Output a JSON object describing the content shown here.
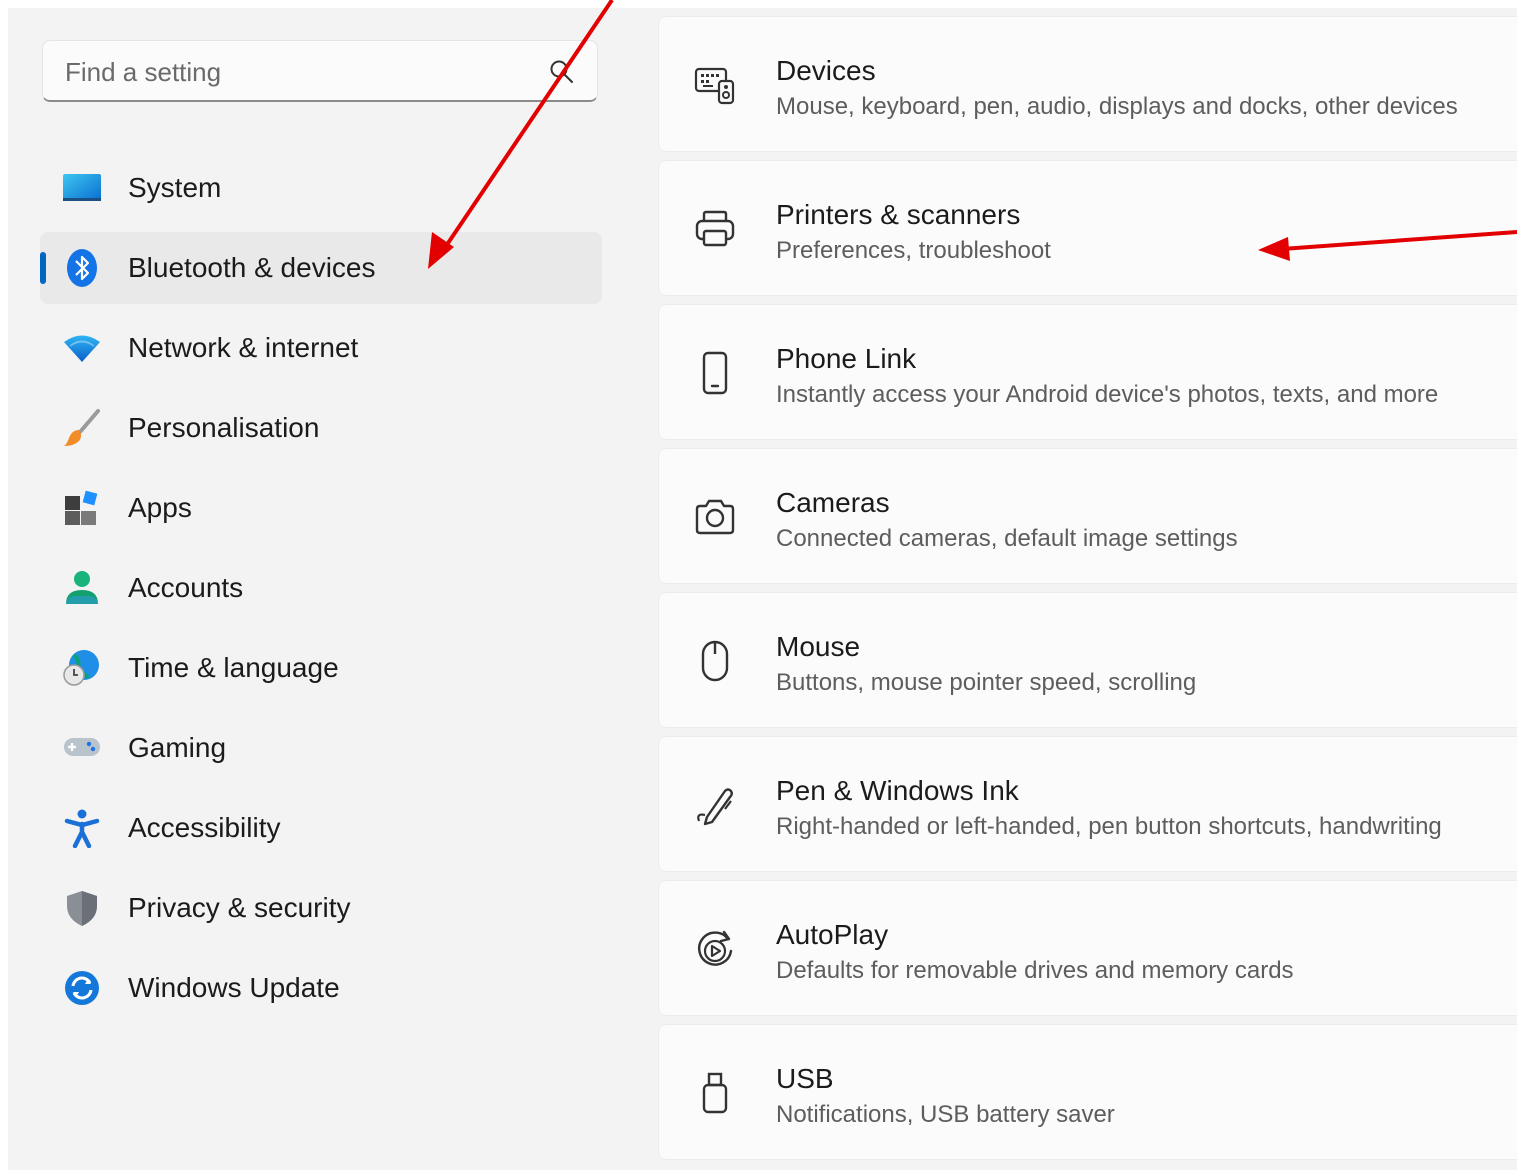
{
  "search": {
    "placeholder": "Find a setting"
  },
  "nav": {
    "items": [
      {
        "label": "System",
        "icon": "monitor-icon"
      },
      {
        "label": "Bluetooth & devices",
        "icon": "bluetooth-icon",
        "selected": true
      },
      {
        "label": "Network & internet",
        "icon": "wifi-icon"
      },
      {
        "label": "Personalisation",
        "icon": "paintbrush-icon"
      },
      {
        "label": "Apps",
        "icon": "apps-icon"
      },
      {
        "label": "Accounts",
        "icon": "person-icon"
      },
      {
        "label": "Time & language",
        "icon": "globe-clock-icon"
      },
      {
        "label": "Gaming",
        "icon": "gamepad-icon"
      },
      {
        "label": "Accessibility",
        "icon": "accessibility-icon"
      },
      {
        "label": "Privacy & security",
        "icon": "shield-icon"
      },
      {
        "label": "Windows Update",
        "icon": "update-icon"
      }
    ]
  },
  "cards": [
    {
      "title": "Devices",
      "subtitle": "Mouse, keyboard, pen, audio, displays and docks, other devices",
      "icon": "devices-icon"
    },
    {
      "title": "Printers & scanners",
      "subtitle": "Preferences, troubleshoot",
      "icon": "printer-icon"
    },
    {
      "title": "Phone Link",
      "subtitle": "Instantly access your Android device's photos, texts, and more",
      "icon": "phone-icon"
    },
    {
      "title": "Cameras",
      "subtitle": "Connected cameras, default image settings",
      "icon": "camera-icon"
    },
    {
      "title": "Mouse",
      "subtitle": "Buttons, mouse pointer speed, scrolling",
      "icon": "mouse-icon"
    },
    {
      "title": "Pen & Windows Ink",
      "subtitle": "Right-handed or left-handed, pen button shortcuts, handwriting",
      "icon": "pen-icon"
    },
    {
      "title": "AutoPlay",
      "subtitle": "Defaults for removable drives and memory cards",
      "icon": "autoplay-icon"
    },
    {
      "title": "USB",
      "subtitle": "Notifications, USB battery saver",
      "icon": "usb-icon"
    }
  ],
  "colors": {
    "accent": "#0067c0",
    "annotation_arrow": "#e30000",
    "background": "#f3f3f3",
    "card": "#fbfbfb"
  }
}
